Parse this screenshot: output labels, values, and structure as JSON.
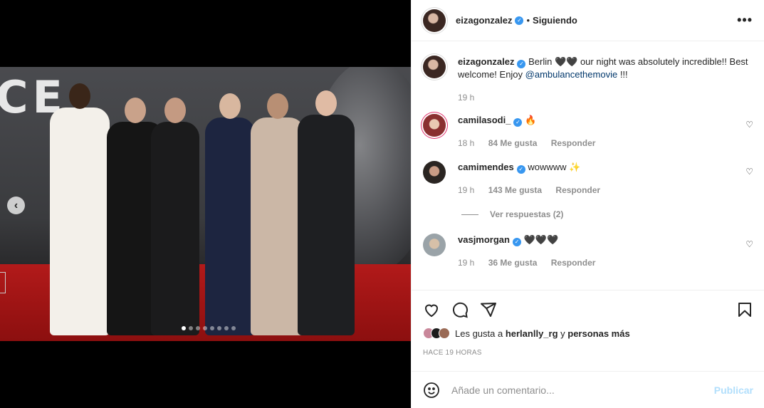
{
  "post": {
    "author": "eizagonzalez",
    "follow_state": "Siguiendo",
    "more_icon": "more-horizontal-icon"
  },
  "media": {
    "backdrop_text": "CE",
    "slide_count": 8,
    "active_slide": 1
  },
  "caption": {
    "username": "eizagonzalez",
    "text_1": "Berlin",
    "hearts": "🖤🖤",
    "text_2": " our night was absolutely incredible!! Best welcome! Enjoy ",
    "mention": "@ambulancethemovie",
    "text_3": " !!!",
    "time": "19 h"
  },
  "comments": [
    {
      "username": "camilasodi_",
      "text": "🔥",
      "time": "18 h",
      "likes": "84 Me gusta",
      "reply": "Responder"
    },
    {
      "username": "camimendes",
      "text": "wowwww ✨",
      "time": "19 h",
      "likes": "143 Me gusta",
      "reply": "Responder",
      "view_replies": "Ver respuestas (2)"
    },
    {
      "username": "vasjmorgan",
      "text": "🖤🖤🖤",
      "time": "19 h",
      "likes": "36 Me gusta",
      "reply": "Responder"
    }
  ],
  "likes": {
    "prefix": "Les gusta a ",
    "user": "herlanlly_rg",
    "middle": " y ",
    "others": "personas más"
  },
  "timestamp": "Hace 19 horas",
  "add_comment": {
    "placeholder": "Añade un comentario...",
    "publish_label": "Publicar"
  },
  "colors": {
    "verified": "#3897f0",
    "link": "#00376b",
    "publish_disabled": "#b2dffc",
    "carpet": "#a51717"
  }
}
